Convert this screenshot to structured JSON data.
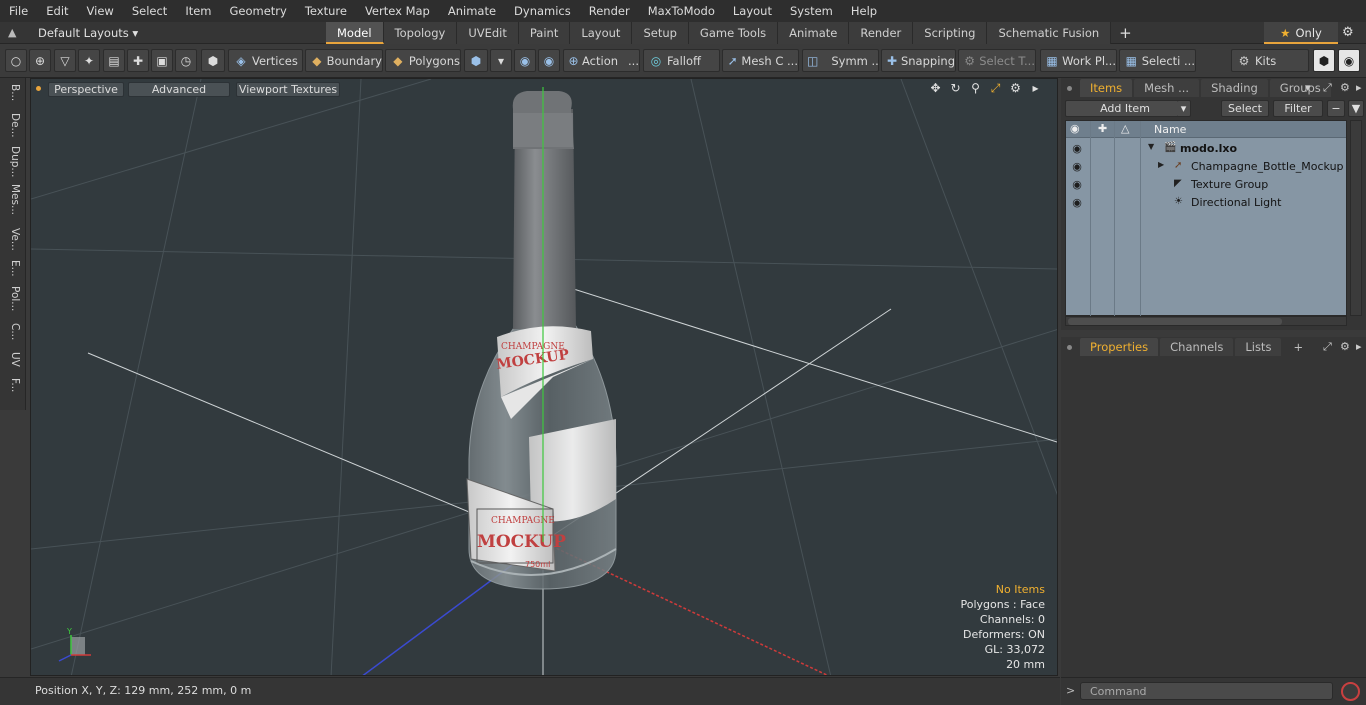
{
  "menu": [
    "File",
    "Edit",
    "View",
    "Select",
    "Item",
    "Geometry",
    "Texture",
    "Vertex Map",
    "Animate",
    "Dynamics",
    "Render",
    "MaxToModo",
    "Layout",
    "System",
    "Help"
  ],
  "layouts": {
    "dropdown": "Default Layouts ▾"
  },
  "tabs": [
    "Model",
    "Topology",
    "UVEdit",
    "Paint",
    "Layout",
    "Setup",
    "Game Tools",
    "Animate",
    "Render",
    "Scripting",
    "Schematic Fusion"
  ],
  "active_tab": "Model",
  "only_label": "Only",
  "toolbar": {
    "vertices": "Vertices",
    "boundary": "Boundary",
    "polygons": "Polygons",
    "action": "Action",
    "falloff": "Falloff",
    "mesh_c": "Mesh C ...",
    "symm": "Symm ...",
    "snapping": "Snapping",
    "select_t": "Select T...",
    "work_pl": "Work Pl...",
    "selecti": "Selecti ...",
    "kits": "Kits"
  },
  "left_tabs": [
    "B...",
    "De...",
    "Dup...",
    "Mes...",
    "Ve...",
    "E...",
    "Pol...",
    "C...",
    "UV",
    "F..."
  ],
  "viewport": {
    "perspective": "Perspective",
    "advanced": "Advanced",
    "textures": "Viewport Textures",
    "info": {
      "no_items": "No Items",
      "polygons": "Polygons : Face",
      "channels": "Channels: 0",
      "deformers": "Deformers: ON",
      "gl": "GL: 33,072",
      "scale": "20 mm"
    },
    "label_champagne": "CHAMPAGNE",
    "label_mockup": "MOCKUP",
    "label_ml": "750ml",
    "axis_y": "Y"
  },
  "status": {
    "position": "Position X, Y, Z:   129 mm, 252 mm, 0 m"
  },
  "items_panel": {
    "tabs": [
      "Items",
      "Mesh ...",
      "Shading",
      "Groups"
    ],
    "add_item": "Add Item",
    "select": "Select",
    "filter": "Filter",
    "name_col": "Name",
    "rows": [
      {
        "label": "modo.lxo"
      },
      {
        "label": "Champagne_Bottle_Mockup"
      },
      {
        "label": "Texture Group"
      },
      {
        "label": "Directional Light"
      }
    ]
  },
  "properties_panel": {
    "tabs": [
      "Properties",
      "Channels",
      "Lists"
    ],
    "plus": "+"
  },
  "command": {
    "placeholder": "Command"
  }
}
